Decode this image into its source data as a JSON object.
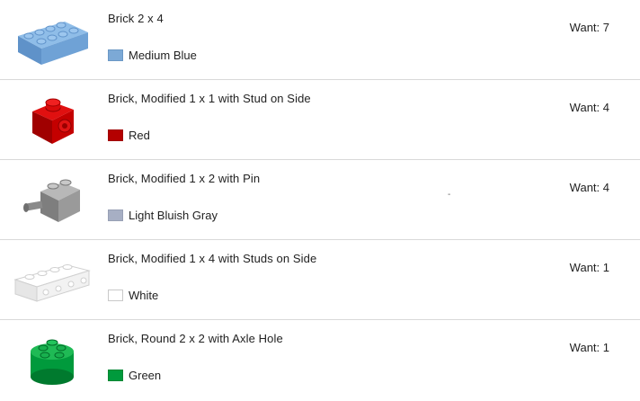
{
  "items": [
    {
      "name": "Brick 2 x 4",
      "color_name": "Medium Blue",
      "color_hex": "#7ca9d6",
      "want": "Want: 7",
      "icon": "brick-2x4-icon"
    },
    {
      "name": "Brick, Modified 1 x 1 with Stud on Side",
      "color_name": "Red",
      "color_hex": "#b40000",
      "want": "Want: 4",
      "icon": "brick-1x1-stud-side-icon"
    },
    {
      "name": "Brick, Modified 1 x 2 with Pin",
      "color_name": "Light Bluish Gray",
      "color_hex": "#a7afc4",
      "want": "Want: 4",
      "extra_mark": "-",
      "icon": "brick-1x2-pin-icon"
    },
    {
      "name": "Brick, Modified 1 x 4 with Studs on Side",
      "color_name": "White",
      "color_hex": "#ffffff",
      "want": "Want: 1",
      "icon": "brick-1x4-studs-side-icon"
    },
    {
      "name": "Brick, Round 2 x 2 with Axle Hole",
      "color_name": "Green",
      "color_hex": "#009a3c",
      "want": "Want: 1",
      "icon": "brick-round-2x2-icon"
    }
  ]
}
